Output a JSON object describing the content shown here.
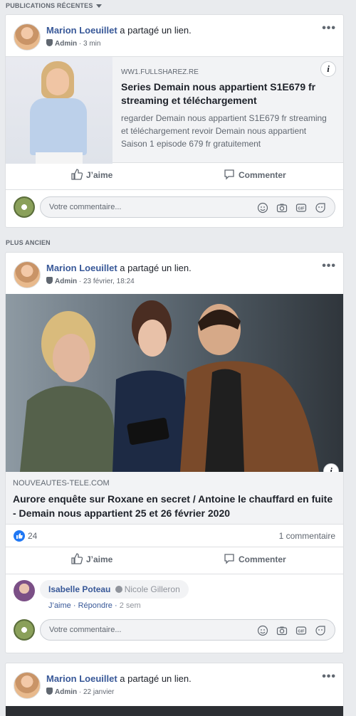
{
  "sections": {
    "recent_label": "PUBLICATIONS RÉCENTES",
    "older_label": "PLUS ANCIEN"
  },
  "colors": {
    "link_blue": "#385898",
    "like_blue": "#2078f4",
    "background": "#e9ebee"
  },
  "posts": [
    {
      "author": "Marion Loeuillet",
      "action": " a partagé un lien.",
      "role": "Admin",
      "time": " · 3 min",
      "link": {
        "domain": "WW1.FULLSHAREZ.RE",
        "title": "Series Demain nous appartient S1E679 fr streaming et téléchargement",
        "description": "regarder Demain nous appartient S1E679 fr streaming et téléchargement revoir Demain nous appartient Saison 1 episode 679 fr gratuitement"
      },
      "like_label": "J’aime",
      "comment_label": "Commenter",
      "comment_placeholder": "Votre commentaire..."
    },
    {
      "author": "Marion Loeuillet",
      "action": " a partagé un lien.",
      "role": "Admin",
      "time": " · 23 février, 18:24",
      "link": {
        "domain": "NOUVEAUTES-TELE.COM",
        "title": "Aurore enquête sur Roxane en secret / Antoine le chauffard en fuite - Demain nous appartient 25 et 26 février 2020"
      },
      "likes": "24",
      "comments_count": "1 commentaire",
      "like_label": "J’aime",
      "comment_label": "Commenter",
      "comment": {
        "author": "Isabelle Poteau",
        "tagged": "Nicole Gilleron",
        "like": "J’aime",
        "reply": "Répondre",
        "time": "2 sem"
      },
      "comment_placeholder": "Votre commentaire..."
    },
    {
      "author": "Marion Loeuillet",
      "action": " a partagé un lien.",
      "role": "Admin",
      "time": " · 22 janvier"
    }
  ],
  "icons": [
    "chevron-down-icon",
    "more-icon",
    "shield-icon",
    "info-icon",
    "like-icon",
    "comment-icon",
    "emoji-icon",
    "camera-icon",
    "gif-icon",
    "sticker-icon",
    "verified-icon"
  ]
}
